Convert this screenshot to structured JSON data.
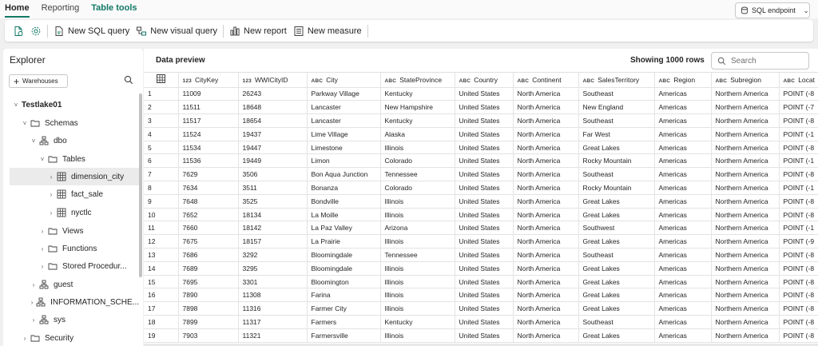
{
  "tabs": [
    "Home",
    "Reporting",
    "Table tools"
  ],
  "endpoint": {
    "label": "SQL endpoint"
  },
  "toolbar": {
    "new_sql_query": "New SQL query",
    "new_visual_query": "New visual query",
    "new_report": "New report",
    "new_measure": "New measure"
  },
  "explorer": {
    "title": "Explorer",
    "warehouses_button": "Warehouses",
    "tree": [
      {
        "label": "Testlake01",
        "level": 0,
        "chevron": "down",
        "icon": "none",
        "bold": true
      },
      {
        "label": "Schemas",
        "level": 1,
        "chevron": "down",
        "icon": "folder-icon"
      },
      {
        "label": "dbo",
        "level": 2,
        "chevron": "down",
        "icon": "schema-icon"
      },
      {
        "label": "Tables",
        "level": 3,
        "chevron": "down",
        "icon": "folder-icon"
      },
      {
        "label": "dimension_city",
        "level": 4,
        "chevron": "right",
        "icon": "table-icon",
        "selected": true
      },
      {
        "label": "fact_sale",
        "level": 4,
        "chevron": "right",
        "icon": "table-icon"
      },
      {
        "label": "nyctlc",
        "level": 4,
        "chevron": "right",
        "icon": "table-icon"
      },
      {
        "label": "Views",
        "level": 3,
        "chevron": "right",
        "icon": "folder-icon"
      },
      {
        "label": "Functions",
        "level": 3,
        "chevron": "right",
        "icon": "folder-icon"
      },
      {
        "label": "Stored Procedur...",
        "level": 3,
        "chevron": "right",
        "icon": "folder-icon"
      },
      {
        "label": "guest",
        "level": 2,
        "chevron": "right",
        "icon": "schema-icon"
      },
      {
        "label": "INFORMATION_SCHE...",
        "level": 2,
        "chevron": "right",
        "icon": "schema-icon"
      },
      {
        "label": "sys",
        "level": 2,
        "chevron": "right",
        "icon": "schema-icon"
      },
      {
        "label": "Security",
        "level": 1,
        "chevron": "right",
        "icon": "folder-icon"
      }
    ]
  },
  "preview": {
    "title": "Data preview",
    "row_count": "Showing 1000 rows",
    "search_placeholder": "Search",
    "columns": [
      {
        "type": "123",
        "name": "CityKey"
      },
      {
        "type": "123",
        "name": "WWICityID"
      },
      {
        "type": "ABC",
        "name": "City"
      },
      {
        "type": "ABC",
        "name": "StateProvince"
      },
      {
        "type": "ABC",
        "name": "Country"
      },
      {
        "type": "ABC",
        "name": "Continent"
      },
      {
        "type": "ABC",
        "name": "SalesTerritory"
      },
      {
        "type": "ABC",
        "name": "Region"
      },
      {
        "type": "ABC",
        "name": "Subregion"
      },
      {
        "type": "ABC",
        "name": "Locat"
      }
    ],
    "rows": [
      [
        "1",
        "11009",
        "26243",
        "Parkway Village",
        "Kentucky",
        "United States",
        "North America",
        "Southeast",
        "Americas",
        "Northern America",
        "POINT (-8"
      ],
      [
        "2",
        "11511",
        "18648",
        "Lancaster",
        "New Hampshire",
        "United States",
        "North America",
        "New England",
        "Americas",
        "Northern America",
        "POINT (-7"
      ],
      [
        "3",
        "11517",
        "18654",
        "Lancaster",
        "Kentucky",
        "United States",
        "North America",
        "Southeast",
        "Americas",
        "Northern America",
        "POINT (-8"
      ],
      [
        "4",
        "11524",
        "19437",
        "Lime Village",
        "Alaska",
        "United States",
        "North America",
        "Far West",
        "Americas",
        "Northern America",
        "POINT (-1"
      ],
      [
        "5",
        "11534",
        "19447",
        "Limestone",
        "Illinois",
        "United States",
        "North America",
        "Great Lakes",
        "Americas",
        "Northern America",
        "POINT (-8"
      ],
      [
        "6",
        "11536",
        "19449",
        "Limon",
        "Colorado",
        "United States",
        "North America",
        "Rocky Mountain",
        "Americas",
        "Northern America",
        "POINT (-1"
      ],
      [
        "7",
        "7629",
        "3506",
        "Bon Aqua Junction",
        "Tennessee",
        "United States",
        "North America",
        "Southeast",
        "Americas",
        "Northern America",
        "POINT (-8"
      ],
      [
        "8",
        "7634",
        "3511",
        "Bonanza",
        "Colorado",
        "United States",
        "North America",
        "Rocky Mountain",
        "Americas",
        "Northern America",
        "POINT (-1"
      ],
      [
        "9",
        "7648",
        "3525",
        "Bondville",
        "Illinois",
        "United States",
        "North America",
        "Great Lakes",
        "Americas",
        "Northern America",
        "POINT (-8"
      ],
      [
        "10",
        "7652",
        "18134",
        "La Moille",
        "Illinois",
        "United States",
        "North America",
        "Great Lakes",
        "Americas",
        "Northern America",
        "POINT (-8"
      ],
      [
        "11",
        "7660",
        "18142",
        "La Paz Valley",
        "Arizona",
        "United States",
        "North America",
        "Southwest",
        "Americas",
        "Northern America",
        "POINT (-1"
      ],
      [
        "12",
        "7675",
        "18157",
        "La Prairie",
        "Illinois",
        "United States",
        "North America",
        "Great Lakes",
        "Americas",
        "Northern America",
        "POINT (-9"
      ],
      [
        "13",
        "7686",
        "3292",
        "Bloomingdale",
        "Tennessee",
        "United States",
        "North America",
        "Southeast",
        "Americas",
        "Northern America",
        "POINT (-8"
      ],
      [
        "14",
        "7689",
        "3295",
        "Bloomingdale",
        "Illinois",
        "United States",
        "North America",
        "Great Lakes",
        "Americas",
        "Northern America",
        "POINT (-8"
      ],
      [
        "15",
        "7695",
        "3301",
        "Bloomington",
        "Illinois",
        "United States",
        "North America",
        "Great Lakes",
        "Americas",
        "Northern America",
        "POINT (-8"
      ],
      [
        "16",
        "7890",
        "11308",
        "Farina",
        "Illinois",
        "United States",
        "North America",
        "Great Lakes",
        "Americas",
        "Northern America",
        "POINT (-8"
      ],
      [
        "17",
        "7898",
        "11316",
        "Farmer City",
        "Illinois",
        "United States",
        "North America",
        "Great Lakes",
        "Americas",
        "Northern America",
        "POINT (-8"
      ],
      [
        "18",
        "7899",
        "11317",
        "Farmers",
        "Kentucky",
        "United States",
        "North America",
        "Southeast",
        "Americas",
        "Northern America",
        "POINT (-8"
      ],
      [
        "19",
        "7903",
        "11321",
        "Farmersville",
        "Illinois",
        "United States",
        "North America",
        "Great Lakes",
        "Americas",
        "Northern America",
        "POINT (-8"
      ]
    ]
  },
  "colors": {
    "accent": "#117865",
    "selected": "#ebebeb",
    "border": "#e3e3e3"
  }
}
